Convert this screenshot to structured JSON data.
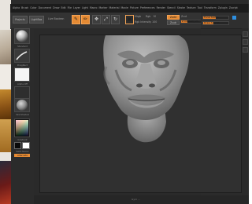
{
  "menubar": {
    "items": [
      "Alpha",
      "Brush",
      "Color",
      "Document",
      "Draw",
      "Edit",
      "File",
      "Layer",
      "Light",
      "Macro",
      "Marker",
      "Material",
      "Movie",
      "Picture",
      "Preferences",
      "Render",
      "Stencil",
      "Stroke",
      "Texture",
      "Tool",
      "Transform",
      "Zplugin",
      "Zscript"
    ]
  },
  "statusline": {
    "text": "ZBrush 4R6 ..."
  },
  "shelf": {
    "projects_label": "Projects",
    "lightbox_label": "LightBox",
    "live_boolean_label": "Live Boolean",
    "tools": [
      {
        "name": "edit",
        "glyph": "✎",
        "active": true
      },
      {
        "name": "draw",
        "glyph": "✏",
        "active": true
      },
      {
        "name": "move",
        "glyph": "✥",
        "active": false
      },
      {
        "name": "scale",
        "glyph": "⤢",
        "active": false
      },
      {
        "name": "rotate",
        "glyph": "↻",
        "active": false
      },
      {
        "name": "transpose",
        "glyph": "▣",
        "active": true
      }
    ],
    "mrgb_label": "Mrgb",
    "rgb_label": "Rgb",
    "m_label": "M",
    "zadd_label": "Zadd",
    "zsub_label": "Zsub",
    "zcut_label": "Zcut",
    "focal_shift": {
      "label": "Focal Shift 0",
      "value": 0.5
    },
    "draw_size": {
      "label": "Draw Size 64",
      "value": 0.4
    },
    "z_intensity": {
      "label": "Z Intensity 25",
      "value": 0.25
    },
    "rgb_intensity": {
      "label": "Rgb Intensity 100",
      "value": 1.0
    }
  },
  "lefttray": {
    "brush_label": "Standard",
    "stroke_label": "DragRect",
    "alpha_label": "Alpha Off",
    "texture_label": "Texture Off",
    "material_label": "SkinShade4",
    "gradient_label": "Gradient",
    "switch_color_label": "SwitchColor",
    "alternate_label": "Alternate"
  },
  "canvas": {
    "bottom_label": "Gyro ..."
  },
  "colors": {
    "accent": "#e58a33",
    "clay": "#8f8f8f",
    "background": "#2b2b2b"
  }
}
